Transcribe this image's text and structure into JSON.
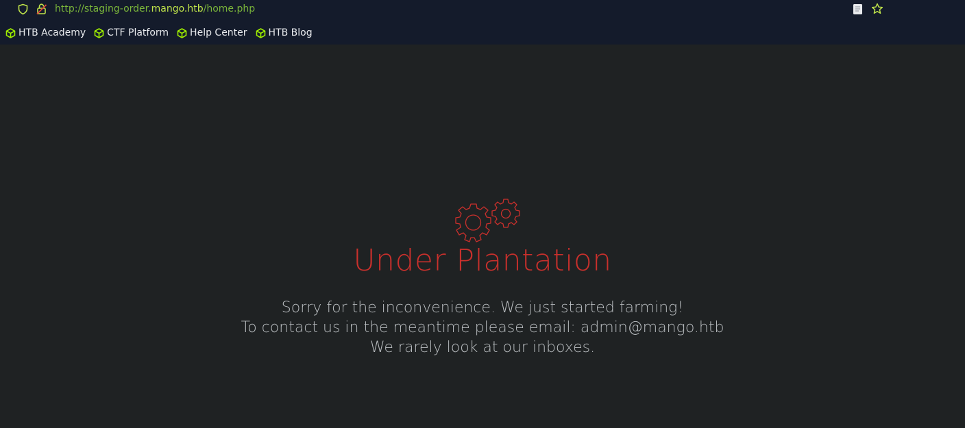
{
  "address_bar": {
    "url_prefix": "http://staging-order.",
    "url_host": "mango.htb",
    "url_path": "/home.php"
  },
  "bookmarks": [
    {
      "label": "HTB Academy",
      "icon": "cube-icon"
    },
    {
      "label": "CTF Platform",
      "icon": "cube-icon"
    },
    {
      "label": "Help Center",
      "icon": "cube-icon"
    },
    {
      "label": "HTB Blog",
      "icon": "cube-icon"
    }
  ],
  "page": {
    "icon": "gears-icon",
    "title": "Under Plantation",
    "lines": [
      "Sorry for the inconvenience. We just started farming!",
      "To contact us in the meantime please email: admin@mango.htb",
      "We rarely look at our inboxes."
    ]
  },
  "colors": {
    "chrome_bg": "#141b2b",
    "page_bg": "#1f2223",
    "accent_green": "#bfe34a",
    "title_red": "#c9302c",
    "text_gray": "#b8bcbf"
  }
}
